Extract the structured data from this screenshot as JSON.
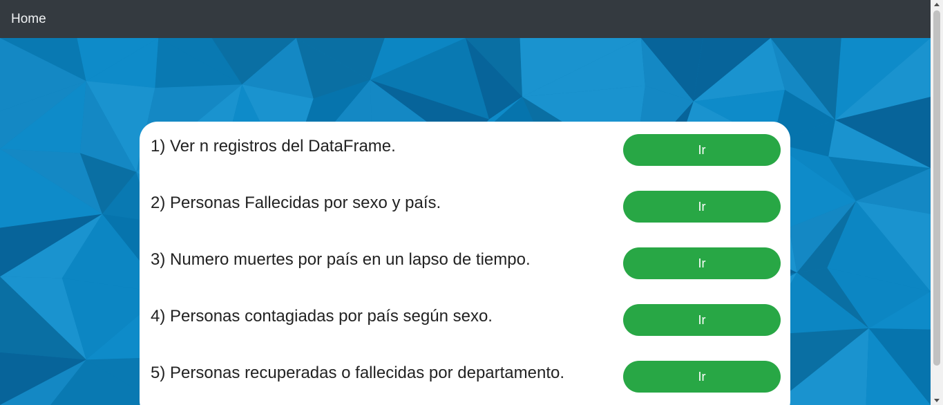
{
  "navbar": {
    "brand": "Home"
  },
  "colors": {
    "navbar": "#343a40",
    "background": "#0b7fb8",
    "card": "#ffffff",
    "button": "#28a745",
    "button_text": "#ffffff"
  },
  "options": [
    {
      "label": "1) Ver n registros del DataFrame.",
      "button": "Ir"
    },
    {
      "label": "2) Personas Fallecidas por sexo y país.",
      "button": "Ir"
    },
    {
      "label": "3) Numero muertes por país en un lapso de tiempo.",
      "button": "Ir"
    },
    {
      "label": "4) Personas contagiadas por país según sexo.",
      "button": "Ir"
    },
    {
      "label": "5) Personas recuperadas o fallecidas por departamento.",
      "button": "Ir"
    }
  ]
}
